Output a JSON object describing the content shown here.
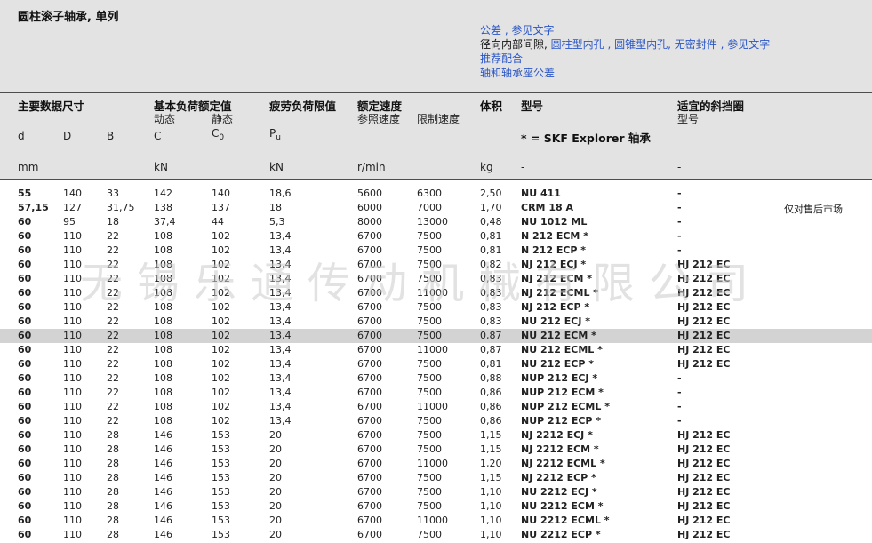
{
  "title": "圆柱滚子轴承, 单列",
  "links": {
    "line1": "公差 , 参见文字",
    "line2_prefix": "径向内部间隙, ",
    "line2_link1": "圆柱型内孔",
    "line2_sep1": " , ",
    "line2_link2": "圆锥型内孔",
    "line2_sep2": ", ",
    "line2_link3": "无密封件",
    "line2_sep3": " , ",
    "line2_link4": "参见文字",
    "line3": "推荐配合",
    "line4": "轴和轴承座公差"
  },
  "header": {
    "main_dims": "主要数据尺寸",
    "load_ratings": "基本负荷额定值",
    "dynamic": "动态",
    "static": "静态",
    "fatigue": "疲劳负荷限值",
    "speed": "额定速度",
    "ref_speed": "参照速度",
    "limit_speed": "限制速度",
    "mass": "体积",
    "designation": "型号",
    "ring": "适宜的斜挡圈",
    "ring_type": "型号",
    "d": "d",
    "D": "D",
    "B": "B",
    "C": "C",
    "C0_main": "C",
    "C0_sub": "0",
    "Pu_main": "P",
    "Pu_sub": "u",
    "explorer": "* = SKF Explorer 轴承",
    "unit_mm": "mm",
    "unit_kN1": "kN",
    "unit_kN2": "kN",
    "unit_rmin": "r/min",
    "unit_kg": "kg",
    "unit_dash1": "-",
    "unit_dash2": "-"
  },
  "watermark": "无锡乐通传动机械有限公司",
  "highlight_color": "#d3d3d3",
  "link_color": "#2a56c6",
  "rows": [
    {
      "d": "55",
      "D": "140",
      "B": "33",
      "C": "142",
      "C0": "140",
      "Pu": "18,6",
      "ref": "5600",
      "lim": "6300",
      "kg": "2,50",
      "des": "NU 411",
      "ring": "-",
      "note": ""
    },
    {
      "d": "57,15",
      "D": "127",
      "B": "31,75",
      "C": "138",
      "C0": "137",
      "Pu": "18",
      "ref": "6000",
      "lim": "7000",
      "kg": "1,70",
      "des": "CRM 18 A",
      "ring": "-",
      "note": "仅对售后市场"
    },
    {
      "d": "60",
      "D": "95",
      "B": "18",
      "C": "37,4",
      "C0": "44",
      "Pu": "5,3",
      "ref": "8000",
      "lim": "13000",
      "kg": "0,48",
      "des": "NU 1012 ML",
      "ring": "-",
      "note": ""
    },
    {
      "d": "60",
      "D": "110",
      "B": "22",
      "C": "108",
      "C0": "102",
      "Pu": "13,4",
      "ref": "6700",
      "lim": "7500",
      "kg": "0,81",
      "des": "N 212 ECM *",
      "ring": "-",
      "note": ""
    },
    {
      "d": "60",
      "D": "110",
      "B": "22",
      "C": "108",
      "C0": "102",
      "Pu": "13,4",
      "ref": "6700",
      "lim": "7500",
      "kg": "0,81",
      "des": "N 212 ECP *",
      "ring": "-",
      "note": ""
    },
    {
      "d": "60",
      "D": "110",
      "B": "22",
      "C": "108",
      "C0": "102",
      "Pu": "13,4",
      "ref": "6700",
      "lim": "7500",
      "kg": "0,82",
      "des": "NJ 212 ECJ *",
      "ring": "HJ 212 EC",
      "note": ""
    },
    {
      "d": "60",
      "D": "110",
      "B": "22",
      "C": "108",
      "C0": "102",
      "Pu": "13,4",
      "ref": "6700",
      "lim": "7500",
      "kg": "0,83",
      "des": "NJ 212 ECM *",
      "ring": "HJ 212 EC",
      "note": ""
    },
    {
      "d": "60",
      "D": "110",
      "B": "22",
      "C": "108",
      "C0": "102",
      "Pu": "13,4",
      "ref": "6700",
      "lim": "11000",
      "kg": "0,83",
      "des": "NJ 212 ECML *",
      "ring": "HJ 212 EC",
      "note": ""
    },
    {
      "d": "60",
      "D": "110",
      "B": "22",
      "C": "108",
      "C0": "102",
      "Pu": "13,4",
      "ref": "6700",
      "lim": "7500",
      "kg": "0,83",
      "des": "NJ 212 ECP *",
      "ring": "HJ 212 EC",
      "note": ""
    },
    {
      "d": "60",
      "D": "110",
      "B": "22",
      "C": "108",
      "C0": "102",
      "Pu": "13,4",
      "ref": "6700",
      "lim": "7500",
      "kg": "0,83",
      "des": "NU 212 ECJ *",
      "ring": "HJ 212 EC",
      "note": ""
    },
    {
      "d": "60",
      "D": "110",
      "B": "22",
      "C": "108",
      "C0": "102",
      "Pu": "13,4",
      "ref": "6700",
      "lim": "7500",
      "kg": "0,87",
      "des": "NU 212 ECM *",
      "ring": "HJ 212 EC",
      "note": "",
      "hl": true
    },
    {
      "d": "60",
      "D": "110",
      "B": "22",
      "C": "108",
      "C0": "102",
      "Pu": "13,4",
      "ref": "6700",
      "lim": "11000",
      "kg": "0,87",
      "des": "NU 212 ECML *",
      "ring": "HJ 212 EC",
      "note": ""
    },
    {
      "d": "60",
      "D": "110",
      "B": "22",
      "C": "108",
      "C0": "102",
      "Pu": "13,4",
      "ref": "6700",
      "lim": "7500",
      "kg": "0,81",
      "des": "NU 212 ECP *",
      "ring": "HJ 212 EC",
      "note": ""
    },
    {
      "d": "60",
      "D": "110",
      "B": "22",
      "C": "108",
      "C0": "102",
      "Pu": "13,4",
      "ref": "6700",
      "lim": "7500",
      "kg": "0,88",
      "des": "NUP 212 ECJ *",
      "ring": "-",
      "note": ""
    },
    {
      "d": "60",
      "D": "110",
      "B": "22",
      "C": "108",
      "C0": "102",
      "Pu": "13,4",
      "ref": "6700",
      "lim": "7500",
      "kg": "0,86",
      "des": "NUP 212 ECM *",
      "ring": "-",
      "note": ""
    },
    {
      "d": "60",
      "D": "110",
      "B": "22",
      "C": "108",
      "C0": "102",
      "Pu": "13,4",
      "ref": "6700",
      "lim": "11000",
      "kg": "0,86",
      "des": "NUP 212 ECML *",
      "ring": "-",
      "note": ""
    },
    {
      "d": "60",
      "D": "110",
      "B": "22",
      "C": "108",
      "C0": "102",
      "Pu": "13,4",
      "ref": "6700",
      "lim": "7500",
      "kg": "0,86",
      "des": "NUP 212 ECP *",
      "ring": "-",
      "note": ""
    },
    {
      "d": "60",
      "D": "110",
      "B": "28",
      "C": "146",
      "C0": "153",
      "Pu": "20",
      "ref": "6700",
      "lim": "7500",
      "kg": "1,15",
      "des": "NJ 2212 ECJ *",
      "ring": "HJ 212 EC",
      "note": ""
    },
    {
      "d": "60",
      "D": "110",
      "B": "28",
      "C": "146",
      "C0": "153",
      "Pu": "20",
      "ref": "6700",
      "lim": "7500",
      "kg": "1,15",
      "des": "NJ 2212 ECM *",
      "ring": "HJ 212 EC",
      "note": ""
    },
    {
      "d": "60",
      "D": "110",
      "B": "28",
      "C": "146",
      "C0": "153",
      "Pu": "20",
      "ref": "6700",
      "lim": "11000",
      "kg": "1,20",
      "des": "NJ 2212 ECML *",
      "ring": "HJ 212 EC",
      "note": ""
    },
    {
      "d": "60",
      "D": "110",
      "B": "28",
      "C": "146",
      "C0": "153",
      "Pu": "20",
      "ref": "6700",
      "lim": "7500",
      "kg": "1,15",
      "des": "NJ 2212 ECP *",
      "ring": "HJ 212 EC",
      "note": ""
    },
    {
      "d": "60",
      "D": "110",
      "B": "28",
      "C": "146",
      "C0": "153",
      "Pu": "20",
      "ref": "6700",
      "lim": "7500",
      "kg": "1,10",
      "des": "NU 2212 ECJ *",
      "ring": "HJ 212 EC",
      "note": ""
    },
    {
      "d": "60",
      "D": "110",
      "B": "28",
      "C": "146",
      "C0": "153",
      "Pu": "20",
      "ref": "6700",
      "lim": "7500",
      "kg": "1,10",
      "des": "NU 2212 ECM *",
      "ring": "HJ 212 EC",
      "note": ""
    },
    {
      "d": "60",
      "D": "110",
      "B": "28",
      "C": "146",
      "C0": "153",
      "Pu": "20",
      "ref": "6700",
      "lim": "11000",
      "kg": "1,10",
      "des": "NU 2212 ECML *",
      "ring": "HJ 212 EC",
      "note": ""
    },
    {
      "d": "60",
      "D": "110",
      "B": "28",
      "C": "146",
      "C0": "153",
      "Pu": "20",
      "ref": "6700",
      "lim": "7500",
      "kg": "1,10",
      "des": "NU 2212 ECP *",
      "ring": "HJ 212 EC",
      "note": ""
    }
  ]
}
